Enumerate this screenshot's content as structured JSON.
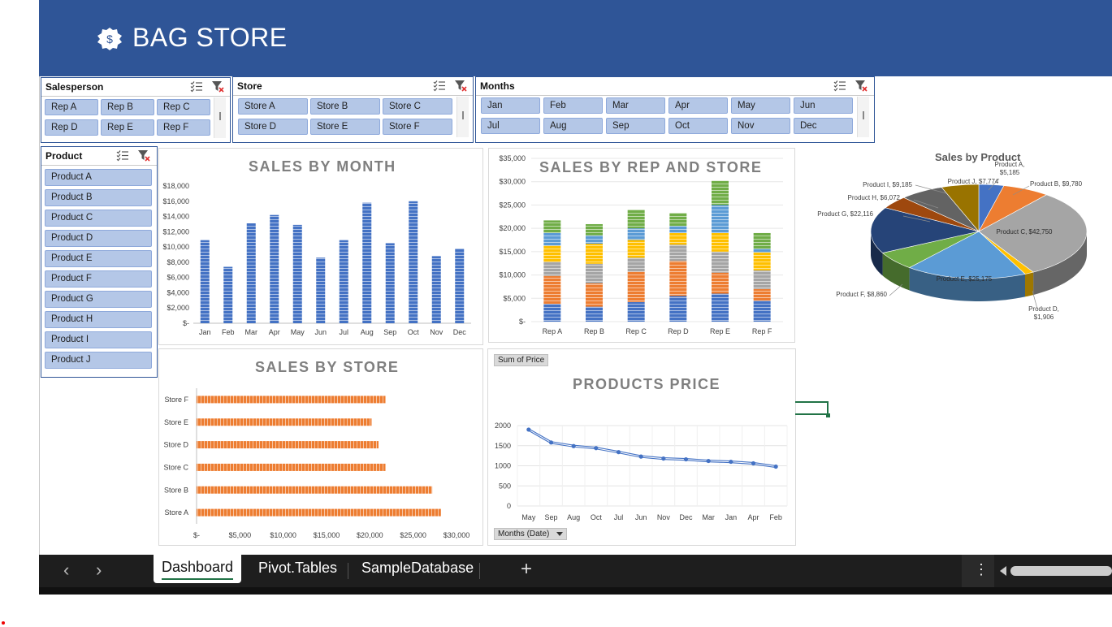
{
  "banner": {
    "title": "BAG STORE",
    "badge_symbol": "$"
  },
  "slicers": {
    "salesperson": {
      "title": "Salesperson",
      "items": [
        "Rep A",
        "Rep B",
        "Rep C",
        "Rep D",
        "Rep E",
        "Rep F"
      ]
    },
    "store": {
      "title": "Store",
      "items": [
        "Store A",
        "Store B",
        "Store C",
        "Store D",
        "Store E",
        "Store F"
      ]
    },
    "months": {
      "title": "Months",
      "items": [
        "Jan",
        "Feb",
        "Mar",
        "Apr",
        "May",
        "Jun",
        "Jul",
        "Aug",
        "Sep",
        "Oct",
        "Nov",
        "Dec"
      ]
    },
    "product": {
      "title": "Product",
      "items": [
        "Product A",
        "Product B",
        "Product C",
        "Product D",
        "Product E",
        "Product F",
        "Product G",
        "Product H",
        "Product I",
        "Product J"
      ]
    }
  },
  "chart_data": [
    {
      "id": "sales_by_month",
      "type": "bar",
      "title": "SALES BY MONTH",
      "categories": [
        "Jan",
        "Feb",
        "Mar",
        "Apr",
        "May",
        "Jun",
        "Jul",
        "Aug",
        "Sep",
        "Oct",
        "Nov",
        "Dec"
      ],
      "values": [
        10900,
        7400,
        13100,
        14200,
        12900,
        8600,
        10900,
        15800,
        10500,
        16000,
        8800,
        9800
      ],
      "ylim": [
        0,
        18000
      ],
      "yticks": [
        "$-",
        "$2,000",
        "$4,000",
        "$6,000",
        "$8,000",
        "$10,000",
        "$12,000",
        "$14,000",
        "$16,000",
        "$18,000"
      ],
      "color": "#4472c4"
    },
    {
      "id": "sales_by_rep_and_store",
      "type": "bar",
      "stacked": true,
      "title": "SALES BY REP AND STORE",
      "categories": [
        "Rep A",
        "Rep B",
        "Rep C",
        "Rep D",
        "Rep E",
        "Rep F"
      ],
      "series": [
        {
          "color": "#4472c4",
          "values": [
            3800,
            3200,
            4200,
            5500,
            6000,
            4500
          ]
        },
        {
          "color": "#ed7d31",
          "values": [
            6000,
            5000,
            6500,
            7500,
            4500,
            2500
          ]
        },
        {
          "color": "#a5a5a5",
          "values": [
            3000,
            4200,
            3000,
            3500,
            4500,
            4000
          ]
        },
        {
          "color": "#ffc000",
          "values": [
            3500,
            4300,
            3800,
            2500,
            4000,
            3800
          ]
        },
        {
          "color": "#5b9bd5",
          "values": [
            2700,
            1800,
            2500,
            1500,
            6000,
            800
          ]
        },
        {
          "color": "#70ad47",
          "values": [
            2700,
            2400,
            4000,
            2800,
            5200,
            3400
          ]
        }
      ],
      "ylim": [
        0,
        35000
      ],
      "yticks": [
        "$-",
        "$5,000",
        "$10,000",
        "$15,000",
        "$20,000",
        "$25,000",
        "$30,000",
        "$35,000"
      ]
    },
    {
      "id": "sales_by_product",
      "type": "pie",
      "title": "Sales by Product",
      "slices": [
        {
          "label": "Product A",
          "value": 5185,
          "display": "Product A, $5,185",
          "color": "#4472c4"
        },
        {
          "label": "Product B",
          "value": 9780,
          "display": "Product B, $9,780",
          "color": "#ed7d31"
        },
        {
          "label": "Product C",
          "value": 42750,
          "display": "Product C, $42,750",
          "color": "#a5a5a5"
        },
        {
          "label": "Product D",
          "value": 1906,
          "display": "Product D, $1,906",
          "color": "#ffc000"
        },
        {
          "label": "Product E",
          "value": 25175,
          "display": "Product E, $25,175",
          "color": "#5b9bd5"
        },
        {
          "label": "Product F",
          "value": 8860,
          "display": "Product F, $8,860",
          "color": "#70ad47"
        },
        {
          "label": "Product G",
          "value": 22116,
          "display": "Product G, $22,116",
          "color": "#264478"
        },
        {
          "label": "Product H",
          "value": 6072,
          "display": "Product H, $6,072",
          "color": "#9e480e"
        },
        {
          "label": "Product I",
          "value": 9185,
          "display": "Product I, $9,185",
          "color": "#636363"
        },
        {
          "label": "Product J",
          "value": 7774,
          "display": "Product J, $7,774",
          "color": "#997300"
        }
      ]
    },
    {
      "id": "sales_by_store",
      "type": "bar",
      "orientation": "horizontal",
      "title": "SALES BY STORE",
      "categories": [
        "Store F",
        "Store E",
        "Store D",
        "Store C",
        "Store B",
        "Store A"
      ],
      "values": [
        21800,
        20200,
        21000,
        21800,
        27200,
        28200
      ],
      "xlim": [
        0,
        30000
      ],
      "xticks": [
        "$-",
        "$5,000",
        "$10,000",
        "$15,000",
        "$20,000",
        "$25,000",
        "$30,000"
      ],
      "color": "#ed7d31"
    },
    {
      "id": "products_price",
      "type": "line",
      "title": "PRODUCTS PRICE",
      "x": [
        "May",
        "Sep",
        "Aug",
        "Oct",
        "Jul",
        "Jun",
        "Nov",
        "Dec",
        "Mar",
        "Jan",
        "Apr",
        "Feb"
      ],
      "values": [
        1900,
        1580,
        1490,
        1440,
        1340,
        1230,
        1180,
        1160,
        1120,
        1100,
        1060,
        980
      ],
      "ylim": [
        0,
        2000
      ],
      "yticks": [
        "0",
        "500",
        "1000",
        "1500",
        "2000"
      ],
      "field_buttons": {
        "values": "Sum of Price",
        "axis": "Months (Date)"
      },
      "color": "#4472c4"
    }
  ],
  "sheet_tabs": {
    "tabs": [
      "Dashboard",
      "Pivot.Tables",
      "SampleDatabase"
    ],
    "active": "Dashboard",
    "add_symbol": "+",
    "nav_prev": "‹",
    "nav_next": "›",
    "more_symbol": "⋮"
  }
}
